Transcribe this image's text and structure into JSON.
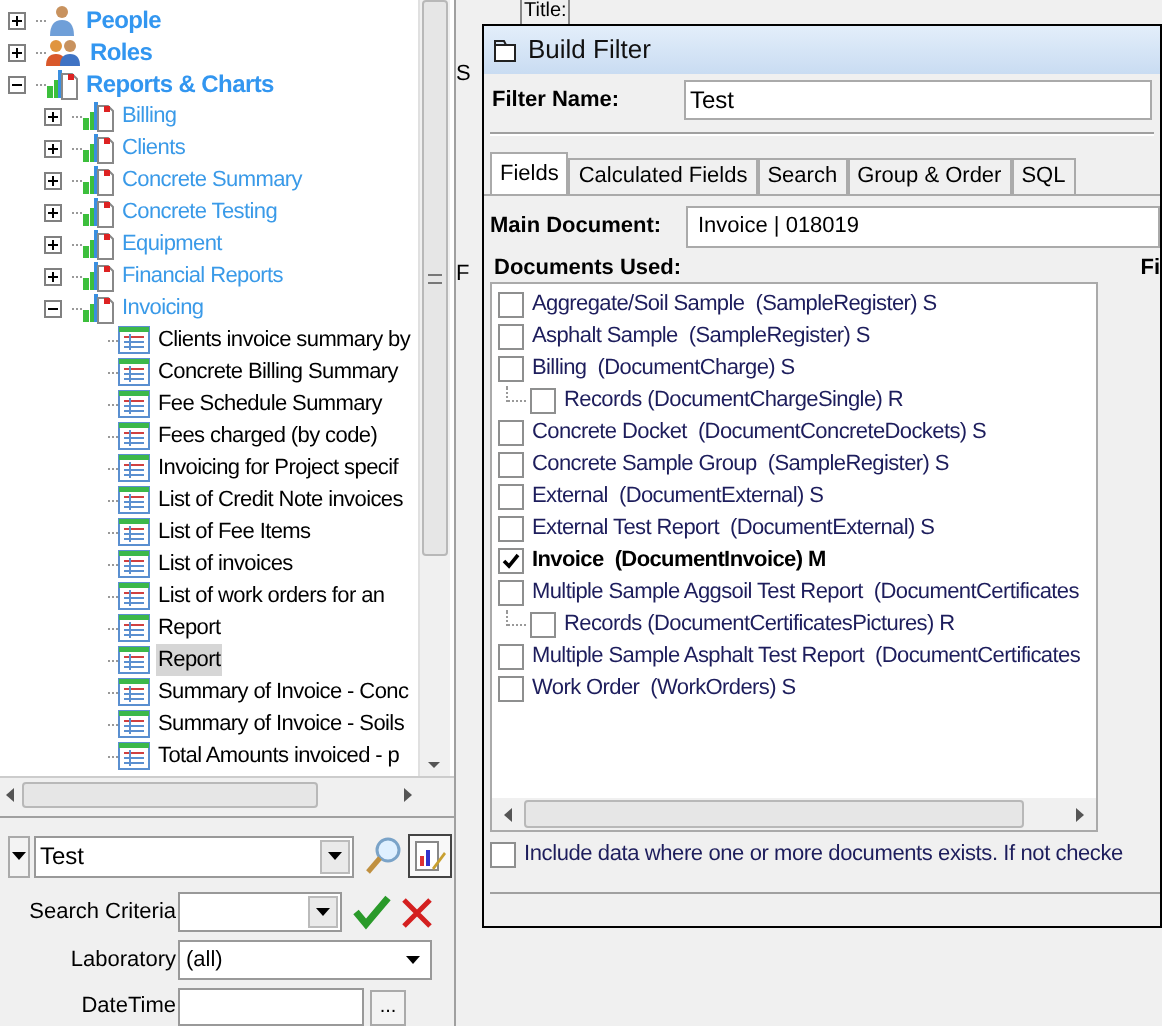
{
  "tree": [
    {
      "label": "People",
      "kind": "people",
      "expanded": false
    },
    {
      "label": "Roles",
      "kind": "roles",
      "expanded": false
    },
    {
      "label": "Reports & Charts",
      "kind": "folder",
      "expanded": true,
      "children": [
        {
          "label": "Billing",
          "kind": "folder",
          "expanded": false
        },
        {
          "label": "Clients",
          "kind": "folder",
          "expanded": false
        },
        {
          "label": "Concrete Summary",
          "kind": "folder",
          "expanded": false
        },
        {
          "label": "Concrete Testing",
          "kind": "folder",
          "expanded": false
        },
        {
          "label": "Equipment",
          "kind": "folder",
          "expanded": false
        },
        {
          "label": "Financial Reports",
          "kind": "folder",
          "expanded": false
        },
        {
          "label": "Invoicing",
          "kind": "folder",
          "expanded": true,
          "children": [
            {
              "label": "Clients invoice summary by",
              "kind": "report",
              "selected": false
            },
            {
              "label": "Concrete Billing Summary",
              "kind": "report",
              "selected": false
            },
            {
              "label": "Fee Schedule Summary",
              "kind": "report",
              "selected": false
            },
            {
              "label": "Fees charged (by code)",
              "kind": "report",
              "selected": false
            },
            {
              "label": "Invoicing for Project specif",
              "kind": "report",
              "selected": false
            },
            {
              "label": "List of Credit Note invoices",
              "kind": "report",
              "selected": false
            },
            {
              "label": "List of Fee Items",
              "kind": "report",
              "selected": false
            },
            {
              "label": "List of invoices",
              "kind": "report",
              "selected": false
            },
            {
              "label": "List of work orders for an",
              "kind": "report",
              "selected": false
            },
            {
              "label": "Report",
              "kind": "report",
              "selected": false
            },
            {
              "label": "Report",
              "kind": "report",
              "selected": true
            },
            {
              "label": "Summary of Invoice - Conc",
              "kind": "report",
              "selected": false
            },
            {
              "label": "Summary of Invoice - Soils",
              "kind": "report",
              "selected": false
            },
            {
              "label": "Total Amounts invoiced - p",
              "kind": "report",
              "selected": false
            }
          ]
        }
      ]
    }
  ],
  "filter_bar": {
    "value": "Test"
  },
  "search_criteria": {
    "label": "Search Criteria"
  },
  "laboratory": {
    "label": "Laboratory",
    "value": "(all)"
  },
  "datetime": {
    "label": "DateTime",
    "button": "..."
  },
  "background": {
    "title_label": "Title:",
    "fragment_1": "S",
    "fragment_2": "F"
  },
  "dialog": {
    "title": "Build Filter",
    "filter_name_label": "Filter Name:",
    "filter_name": "Test",
    "tabs": [
      {
        "label": "Fields",
        "selected": true
      },
      {
        "label": "Calculated Fields",
        "selected": false
      },
      {
        "label": "Search",
        "selected": false
      },
      {
        "label": "Group & Order",
        "selected": false
      },
      {
        "label": "SQL",
        "selected": false
      }
    ],
    "main_document_label": "Main Document:",
    "main_document": "Invoice | 018019",
    "documents_label": "Documents Used:",
    "fields_label": "Fi",
    "documents": [
      {
        "label": "Aggregate/Soil Sample  (SampleRegister) S",
        "checked": false
      },
      {
        "label": "Asphalt Sample  (SampleRegister) S",
        "checked": false
      },
      {
        "label": "Billing  (DocumentCharge) S",
        "checked": false,
        "children": [
          {
            "label": "Records (DocumentChargeSingle) R",
            "checked": false
          }
        ]
      },
      {
        "label": "Concrete Docket  (DocumentConcreteDockets) S",
        "checked": false
      },
      {
        "label": "Concrete Sample Group  (SampleRegister) S",
        "checked": false
      },
      {
        "label": "External  (DocumentExternal) S",
        "checked": false
      },
      {
        "label": "External Test Report  (DocumentExternal) S",
        "checked": false
      },
      {
        "label": "Invoice  (DocumentInvoice) M",
        "checked": true
      },
      {
        "label": "Multiple Sample Aggsoil Test Report  (DocumentCertificates",
        "checked": false,
        "children": [
          {
            "label": "Records (DocumentCertificatesPictures) R",
            "checked": false
          }
        ]
      },
      {
        "label": "Multiple Sample Asphalt Test Report  (DocumentCertificates",
        "checked": false
      },
      {
        "label": "Work Order  (WorkOrders) S",
        "checked": false
      }
    ],
    "include_option": {
      "label": "Include data where one or more documents exists. If not checke",
      "checked": false
    }
  }
}
